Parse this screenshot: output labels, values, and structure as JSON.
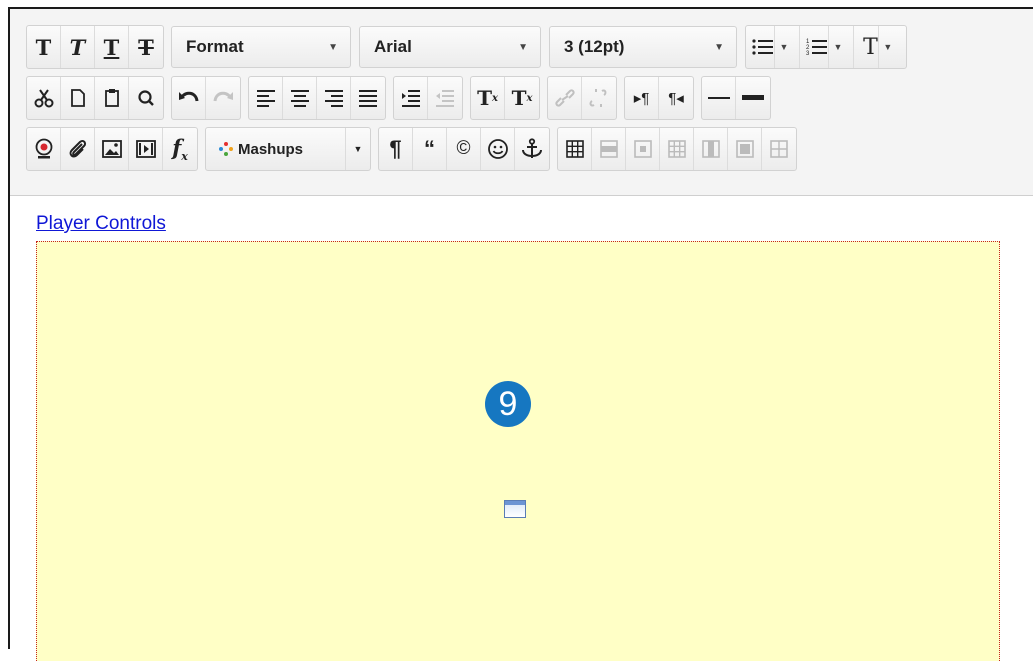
{
  "toolbar": {
    "row1": {
      "format_dropdown": "Format",
      "font_dropdown": "Arial",
      "size_dropdown": "3 (12pt)"
    },
    "row3": {
      "mashups_label": "Mashups"
    }
  },
  "editor": {
    "link_text": "Player Controls",
    "badge_text": "9"
  },
  "colors": {
    "link": "#0f17d6",
    "mashup_background": "#ffffc6",
    "badge": "#1677c1",
    "mashup_border": "#c4231f"
  }
}
